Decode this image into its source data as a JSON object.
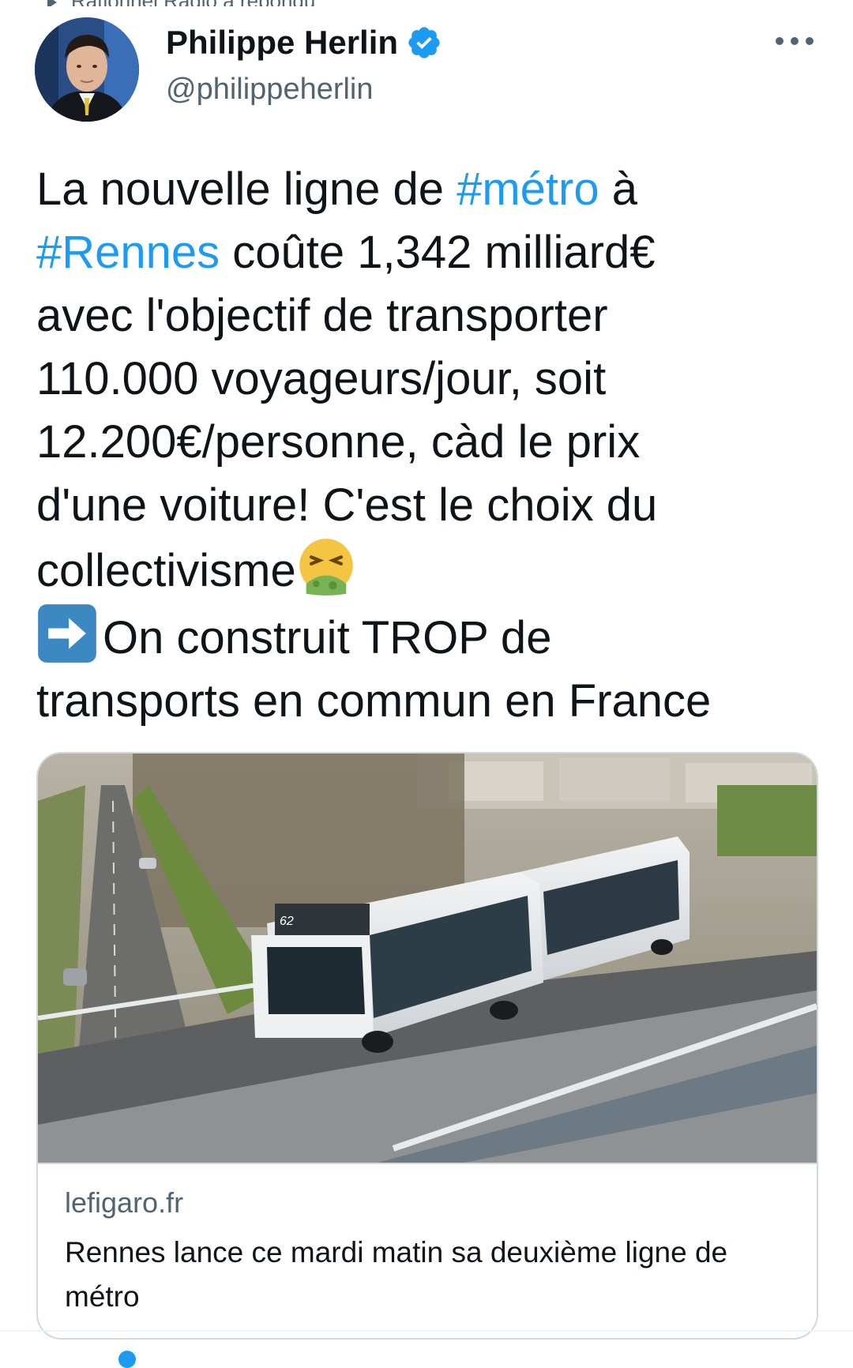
{
  "context": {
    "top_text": "Rationnel Radio a répondu"
  },
  "author": {
    "name": "Philippe Herlin",
    "handle": "@philippeherlin",
    "verified": true,
    "verified_color": "#1d9bf0"
  },
  "tweet": {
    "segments": [
      {
        "text": "La nouvelle ligne de ",
        "hashtag": false
      },
      {
        "text": "#métro",
        "hashtag": true
      },
      {
        "text": " à\n",
        "hashtag": false
      },
      {
        "text": "#Rennes",
        "hashtag": true
      },
      {
        "text": " coûte 1,342 milliard€\navec l'objectif de transporter\n110.000 voyageurs/jour, soit\n12.200€/personne, càd le prix\nd'une voiture! C'est le choix du\ncollectivisme",
        "hashtag": false
      }
    ],
    "emoji_1": "nauseated-face-icon",
    "emoji_2": "right-arrow-icon",
    "line_2": "On construit TROP de\ntransports en commun en France",
    "hashtag_color": "#1d9bf0"
  },
  "link_card": {
    "domain": "lefigaro.fr",
    "title": "Rennes lance ce mardi matin sa deuxième ligne de métro",
    "train_number": "62"
  }
}
